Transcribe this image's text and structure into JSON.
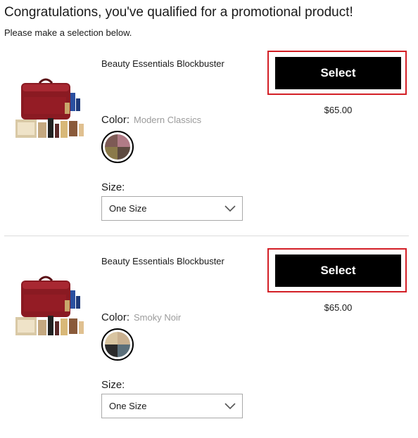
{
  "header": {
    "title": "Congratulations, you've qualified for a promotional product!",
    "subtitle": "Please make a selection below."
  },
  "products": [
    {
      "name": "Beauty Essentials Blockbuster",
      "select_label": "Select",
      "price": "$65.00",
      "color_label": "Color:",
      "color_value": "Modern Classics",
      "swatch_colors": [
        "#7d5a55",
        "#b07b86",
        "#8b7a4a",
        "#5d4a40"
      ],
      "size_label": "Size:",
      "size_value": "One Size"
    },
    {
      "name": "Beauty Essentials Blockbuster",
      "select_label": "Select",
      "price": "$65.00",
      "color_label": "Color:",
      "color_value": "Smoky Noir",
      "swatch_colors": [
        "#d8c4a0",
        "#c9b08f",
        "#2b2b2b",
        "#5b6f7a"
      ],
      "size_label": "Size:",
      "size_value": "One Size"
    }
  ],
  "colors": {
    "accent_frame": "#d31f26",
    "button_bg": "#000000",
    "button_text": "#ffffff",
    "muted_text": "#9b9b9b"
  },
  "icons": {
    "product_image": "product-gift-set-image",
    "dropdown": "chevron-down-icon"
  }
}
